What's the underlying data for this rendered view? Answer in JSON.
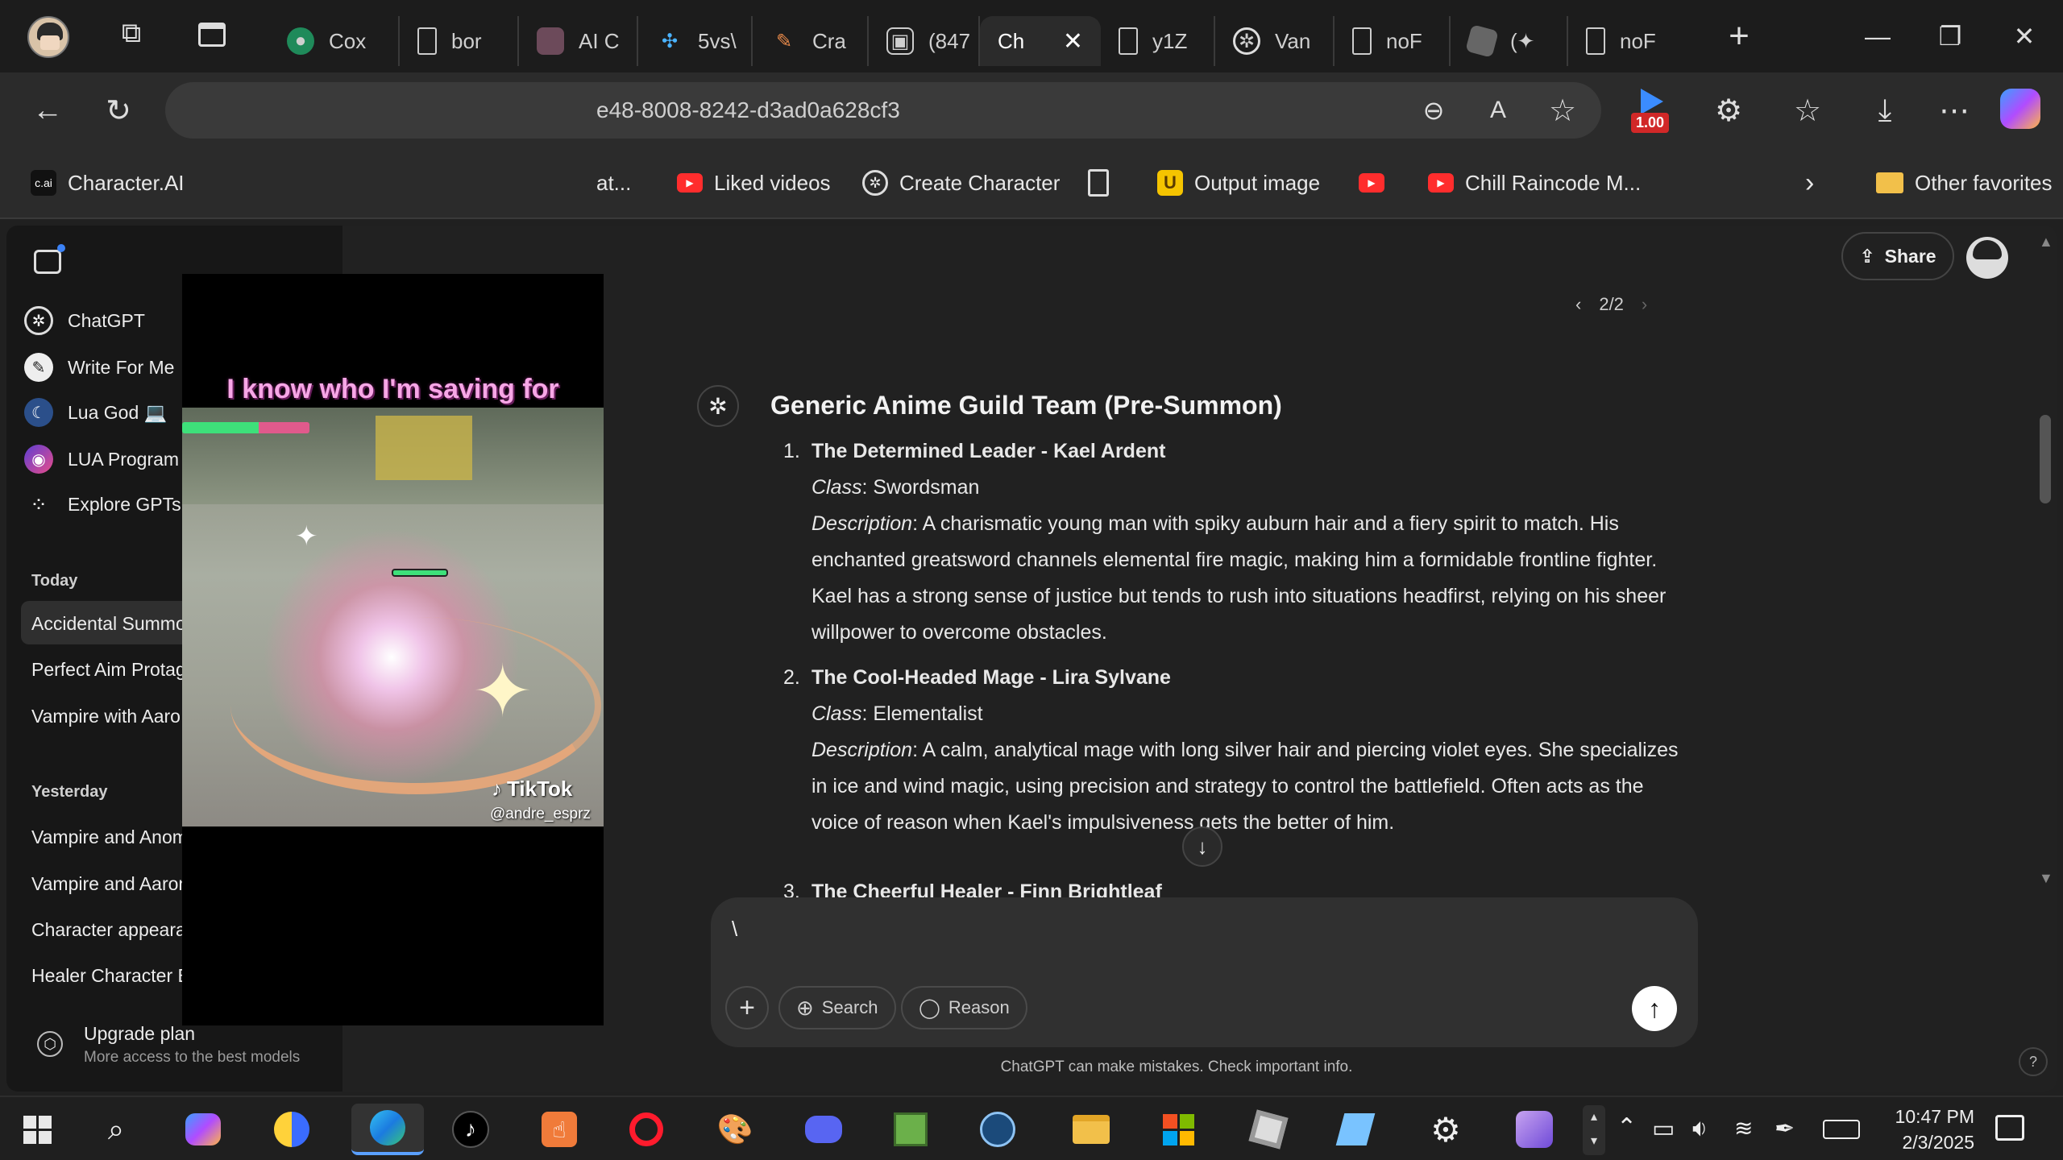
{
  "browser": {
    "tabs": [
      {
        "label": "Cox",
        "icon": "globe-icon"
      },
      {
        "label": "bor",
        "icon": "document-icon"
      },
      {
        "label": "AI C",
        "icon": "image-icon"
      },
      {
        "label": "5vs\\",
        "icon": "pinwheel-icon"
      },
      {
        "label": "Cra",
        "icon": "brush-icon"
      },
      {
        "label": "(847",
        "icon": "media-icon"
      },
      {
        "label": "Ch",
        "icon": "",
        "active": true
      },
      {
        "label": "y1Z",
        "icon": "document-icon"
      },
      {
        "label": "Van",
        "icon": "chatgpt-icon"
      },
      {
        "label": "noF",
        "icon": "document-icon"
      },
      {
        "label": "(✦",
        "icon": "roblox-icon"
      },
      {
        "label": "noF",
        "icon": "document-icon"
      }
    ],
    "url": "e48-8008-8242-d3ad0a628cf3",
    "extension_badge": "1.00",
    "favorites": [
      {
        "label": "Character.AI",
        "icon": "cai-icon"
      },
      {
        "label": "at...",
        "icon": ""
      },
      {
        "label": "Liked videos",
        "icon": "youtube-icon"
      },
      {
        "label": "Create Character",
        "icon": "chatgpt-icon"
      },
      {
        "label": "",
        "icon": "document-icon"
      },
      {
        "label": "Output image",
        "icon": "u-icon"
      },
      {
        "label": "",
        "icon": "youtube-icon"
      },
      {
        "label": "Chill Raincode M...",
        "icon": "youtube-icon"
      },
      {
        "label": "Other favorites",
        "icon": "folder-icon"
      }
    ]
  },
  "sidebar": {
    "gpts": [
      {
        "label": "ChatGPT"
      },
      {
        "label": "Write For Me"
      },
      {
        "label": "Lua God 💻"
      },
      {
        "label": "LUA Program"
      },
      {
        "label": "Explore GPTs"
      }
    ],
    "today_heading": "Today",
    "today": [
      "Accidental Summo",
      "Perfect Aim Protag",
      "Vampire with Aaro"
    ],
    "yesterday_heading": "Yesterday",
    "yesterday": [
      "Vampire and Anomaly Love",
      "Vampire and Aaron's Dynamic",
      "Character appearance descrip",
      "Healer Character Build Review"
    ],
    "upgrade": {
      "title": "Upgrade plan",
      "subtitle": "More access to the best models"
    }
  },
  "chat": {
    "share_label": "Share",
    "pager": "2/2",
    "heading": "Generic Anime Guild Team (Pre-Summon)",
    "items": [
      {
        "num": "1.",
        "title": "The Determined Leader - Kael Ardent",
        "class_label": "Class",
        "class_value": ": Swordsman",
        "desc_label": "Description",
        "desc_lines": [
          ": A charismatic young man with spiky auburn hair and a fiery spirit to match. His",
          "enchanted greatsword channels elemental fire magic, making him a formidable frontline fighter.",
          "Kael has a strong sense of justice but tends to rush into situations headfirst, relying on his sheer",
          "willpower to overcome obstacles."
        ]
      },
      {
        "num": "2.",
        "title": "The Cool-Headed Mage - Lira Sylvane",
        "class_label": "Class",
        "class_value": ": Elementalist",
        "desc_label": "Description",
        "desc_lines": [
          ": A calm, analytical mage with long silver hair and piercing violet eyes. She specializes",
          "in ice and wind magic, using precision and strategy to control the battlefield. Often acts as the",
          "voice of reason when Kael's impulsiveness gets the better of him."
        ]
      },
      {
        "num": "3.",
        "title": "The Cheerful Healer - Finn Brightleaf"
      }
    ],
    "composer_text": "\\",
    "search_label": "Search",
    "reason_label": "Reason",
    "disclaimer": "ChatGPT can make mistakes. Check important info.",
    "help": "?"
  },
  "video_overlay": {
    "caption": "I know who I'm saving for",
    "tiktok_label": "TikTok",
    "handle": "@andre_esprz"
  },
  "taskbar": {
    "time": "10:47 PM",
    "date": "2/3/2025"
  }
}
